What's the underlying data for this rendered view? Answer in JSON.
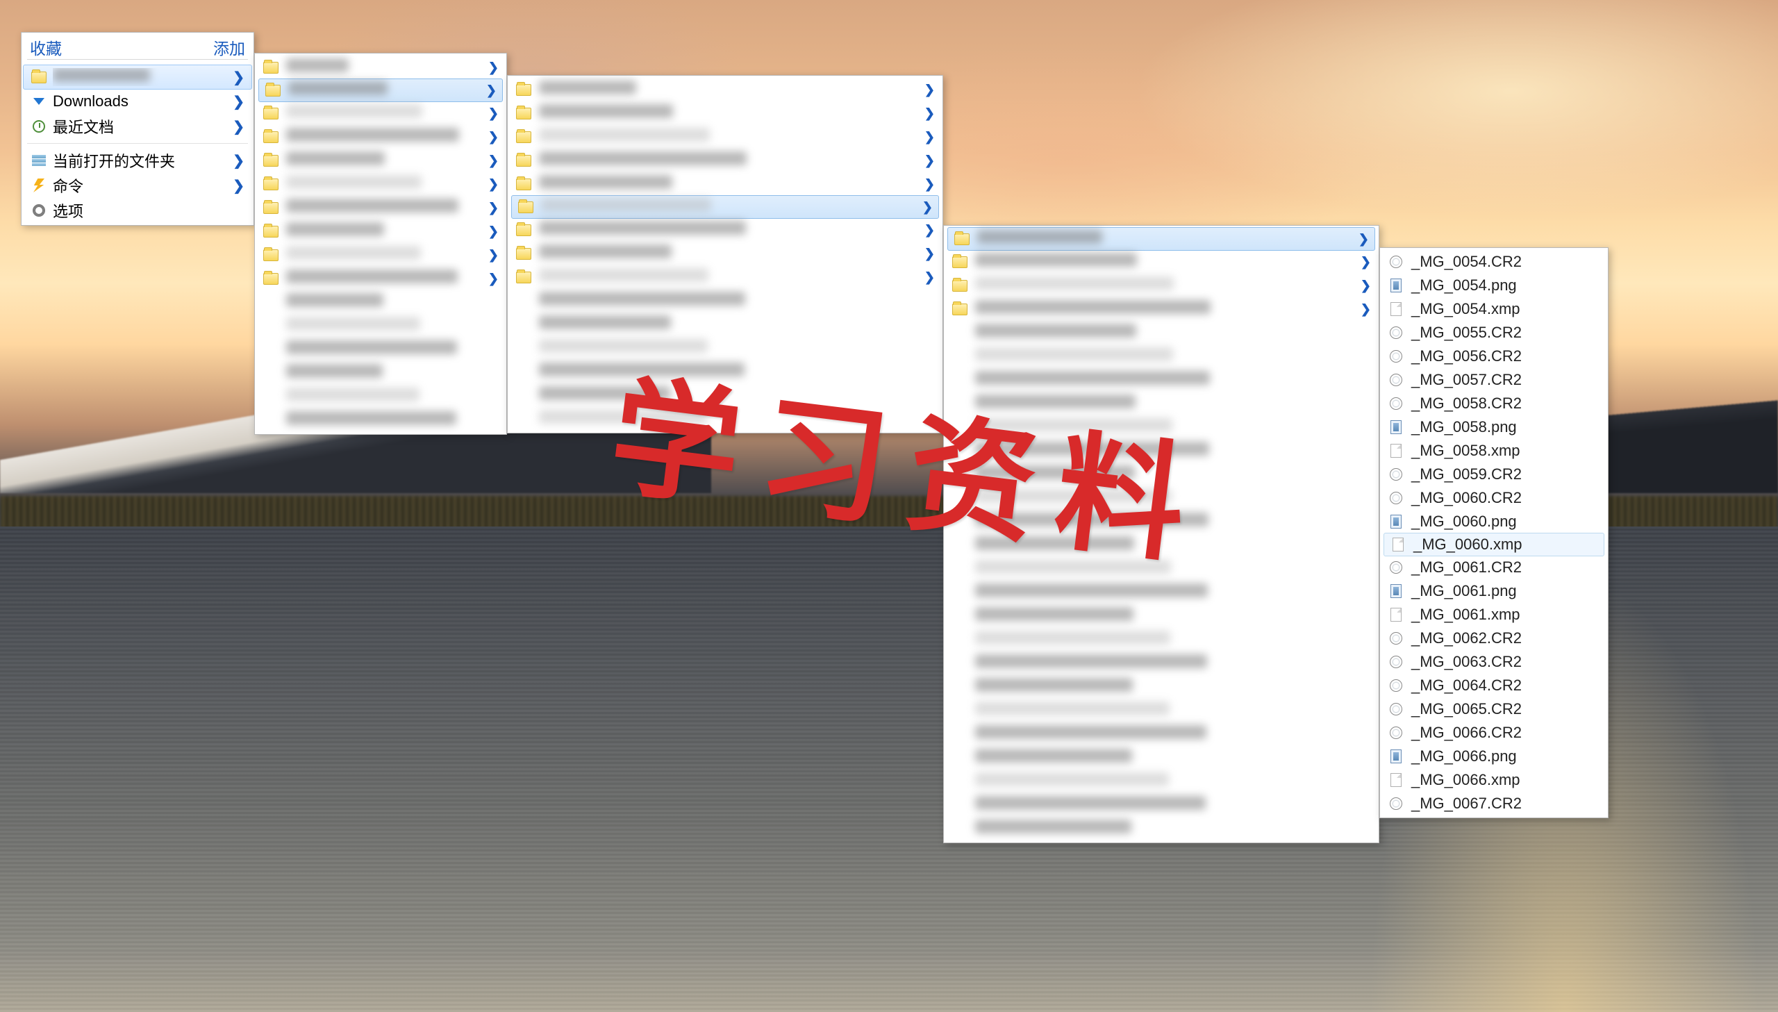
{
  "favorites": {
    "header_left": "收藏",
    "header_right": "添加",
    "items": [
      {
        "icon": "folder",
        "label_hidden": true,
        "chevron": true,
        "selected": true
      },
      {
        "icon": "download",
        "label": "Downloads",
        "chevron": true
      },
      {
        "icon": "clock",
        "label": "最近文档",
        "chevron": true
      }
    ],
    "actions": [
      {
        "icon": "stack",
        "label": "当前打开的文件夹",
        "chevron": true
      },
      {
        "icon": "bolt",
        "label": "命令",
        "chevron": true
      },
      {
        "icon": "gear",
        "label": "选项"
      }
    ]
  },
  "column1": {
    "rows": 16,
    "folder_rows": 10,
    "selected_index": 1,
    "chevron_rows": [
      0,
      1,
      2,
      3,
      4,
      5,
      6,
      7,
      8,
      9
    ]
  },
  "column2": {
    "rows": 15,
    "folder_rows": 9,
    "selected_index": 5,
    "chevron_rows": [
      0,
      1,
      2,
      3,
      4,
      5,
      6,
      7,
      8
    ]
  },
  "column3": {
    "rows": 26,
    "folder_rows": 4,
    "selected_index": 0,
    "chevron_rows": [
      0,
      1,
      2,
      3
    ]
  },
  "column4": {
    "selected_index": 12,
    "files": [
      {
        "icon": "cr2",
        "name": "_MG_0054.CR2"
      },
      {
        "icon": "png",
        "name": "_MG_0054.png"
      },
      {
        "icon": "xmp",
        "name": "_MG_0054.xmp"
      },
      {
        "icon": "cr2",
        "name": "_MG_0055.CR2"
      },
      {
        "icon": "cr2",
        "name": "_MG_0056.CR2"
      },
      {
        "icon": "cr2",
        "name": "_MG_0057.CR2"
      },
      {
        "icon": "cr2",
        "name": "_MG_0058.CR2"
      },
      {
        "icon": "png",
        "name": "_MG_0058.png"
      },
      {
        "icon": "xmp",
        "name": "_MG_0058.xmp"
      },
      {
        "icon": "cr2",
        "name": "_MG_0059.CR2"
      },
      {
        "icon": "cr2",
        "name": "_MG_0060.CR2"
      },
      {
        "icon": "png",
        "name": "_MG_0060.png"
      },
      {
        "icon": "xmp",
        "name": "_MG_0060.xmp"
      },
      {
        "icon": "cr2",
        "name": "_MG_0061.CR2"
      },
      {
        "icon": "png",
        "name": "_MG_0061.png"
      },
      {
        "icon": "xmp",
        "name": "_MG_0061.xmp"
      },
      {
        "icon": "cr2",
        "name": "_MG_0062.CR2"
      },
      {
        "icon": "cr2",
        "name": "_MG_0063.CR2"
      },
      {
        "icon": "cr2",
        "name": "_MG_0064.CR2"
      },
      {
        "icon": "cr2",
        "name": "_MG_0065.CR2"
      },
      {
        "icon": "cr2",
        "name": "_MG_0066.CR2"
      },
      {
        "icon": "png",
        "name": "_MG_0066.png"
      },
      {
        "icon": "xmp",
        "name": "_MG_0066.xmp"
      },
      {
        "icon": "cr2",
        "name": "_MG_0067.CR2"
      }
    ]
  },
  "watermark": "学习资料"
}
